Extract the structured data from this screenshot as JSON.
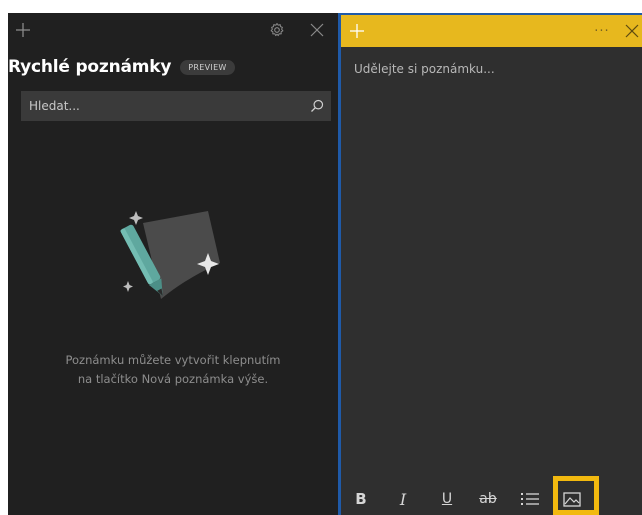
{
  "notes_list": {
    "title": "Rychlé poznámky",
    "badge": "PREVIEW",
    "search": {
      "placeholder": "Hledat...",
      "value": ""
    },
    "empty_message_line1": "Poznámku můžete vytvořit klepnutím",
    "empty_message_line2": "na tlačítko Nová poznámka výše.",
    "icons": {
      "add": "plus-icon",
      "settings": "gear-icon",
      "close": "close-icon",
      "search": "search-icon"
    }
  },
  "note_editor": {
    "placeholder": "Udělejte si poznámku...",
    "header_color": "#e7b81e",
    "more_label": "···",
    "toolbar": {
      "bold": "B",
      "italic": "I",
      "underline": "U",
      "strikethrough": "ab",
      "list": "list-icon",
      "image": "image-icon"
    }
  },
  "colors": {
    "panel_bg": "#202020",
    "editor_bg": "#2f2f2f",
    "accent_blue": "#1f5aa8",
    "highlight": "#f2b90f"
  }
}
